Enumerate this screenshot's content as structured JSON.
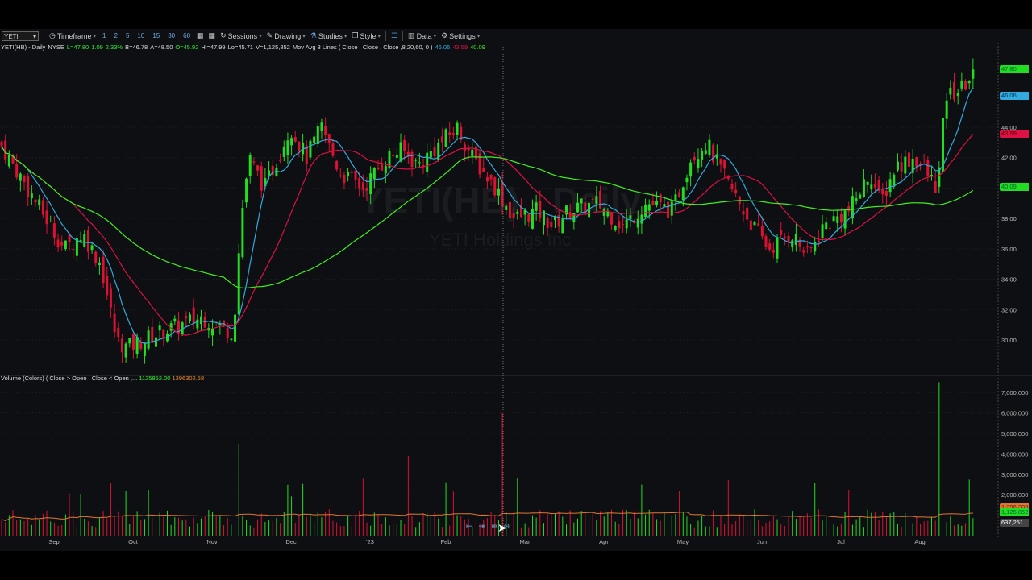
{
  "toolbar": {
    "symbol": "YETI",
    "timeframe": "Timeframe",
    "intervals": [
      "1",
      "2",
      "5",
      "10",
      "15",
      "30",
      "60"
    ],
    "sessions": "Sessions",
    "drawing": "Drawing",
    "studies": "Studies",
    "style": "Style",
    "data": "Data",
    "settings": "Settings"
  },
  "info": {
    "title": "YETI(HB) - Daily",
    "exchange": "NYSE",
    "last": "L=47.80",
    "change": "1.09",
    "pct": "2.33%",
    "bid": "B=46.78",
    "ask": "A=48.50",
    "open": "O=45.92",
    "high": "Hi=47.99",
    "low": "Lo=45.71",
    "volume": "V=1,125,852",
    "study": "Mov Avg 3 Lines ( Close , Close , Close ,8,20,60, 0 )",
    "ma1": "46.06",
    "ma2": "43.59",
    "ma3": "40.09"
  },
  "volume_info": {
    "label": "Volume (Colors) ( Close > Open , Close < Open ,...",
    "v1": "1125852.00",
    "v2": "1396302.58"
  },
  "watermark": {
    "title": "YETI(HB) - Daily",
    "company": "YETI Holdings Inc"
  },
  "colors": {
    "up": "#22dd22",
    "down": "#dd1133",
    "ma8": "#33aadd",
    "ma20": "#dd1144",
    "ma60": "#44ee22",
    "volavg": "#dd7733"
  },
  "price_axis": [
    "44.00",
    "42.00",
    "40.00",
    "38.00",
    "36.00",
    "34.00",
    "32.00",
    "30.00"
  ],
  "price_tags": {
    "last": "47.80",
    "ma8": "46.06",
    "ma20": "43.59",
    "ma60": "40.09"
  },
  "volume_axis": [
    "7,000,000",
    "6,000,000",
    "5,000,000",
    "4,000,000",
    "3,000,000",
    "2,000,000"
  ],
  "volume_tags": {
    "avg": "1,396,303",
    "last": "1,125,852",
    "cursor": "637,251"
  },
  "months": [
    "Sep",
    "Oct",
    "Nov",
    "Dec",
    "'23",
    "Feb",
    "Mar",
    "Apr",
    "May",
    "Jun",
    "Jul",
    "Aug"
  ],
  "chart_data": {
    "type": "candlestick",
    "moving_averages": [
      8,
      20,
      60
    ],
    "ylim": [
      29,
      48.5
    ],
    "volume_ylim": [
      0,
      7500000
    ],
    "close_path": [
      [
        "2022-08-11",
        43
      ],
      [
        "2022-09-05",
        36
      ],
      [
        "2022-09-12",
        37
      ],
      [
        "2022-09-19",
        35
      ],
      [
        "2022-09-25",
        30
      ],
      [
        "2022-09-29",
        29.5
      ],
      [
        "2022-10-12",
        30.5
      ],
      [
        "2022-10-28",
        31.5
      ],
      [
        "2022-11-09",
        30.5
      ],
      [
        "2022-11-12",
        38
      ],
      [
        "2022-11-15",
        42
      ],
      [
        "2022-11-21",
        40
      ],
      [
        "2022-12-01",
        44
      ],
      [
        "2022-12-07",
        42
      ],
      [
        "2022-12-13",
        44
      ],
      [
        "2022-12-20",
        41
      ],
      [
        "2022-12-29",
        40
      ],
      [
        "2023-01-07",
        42
      ],
      [
        "2023-01-13",
        42.5
      ],
      [
        "2023-01-19",
        41.5
      ],
      [
        "2023-02-03",
        44
      ],
      [
        "2023-02-09",
        42
      ],
      [
        "2023-02-18",
        40
      ],
      [
        "2023-02-25",
        38
      ],
      [
        "2023-03-06",
        38.5
      ],
      [
        "2023-03-12",
        37.5
      ],
      [
        "2023-03-18",
        38.5
      ],
      [
        "2023-03-29",
        39
      ],
      [
        "2023-04-08",
        37.5
      ],
      [
        "2023-04-17",
        39
      ],
      [
        "2023-04-27",
        38.5
      ],
      [
        "2023-05-04",
        42
      ],
      [
        "2023-05-10",
        43
      ],
      [
        "2023-05-16",
        41
      ],
      [
        "2023-05-26",
        38
      ],
      [
        "2023-06-03",
        36
      ],
      [
        "2023-06-12",
        37
      ],
      [
        "2023-06-18",
        35.5
      ],
      [
        "2023-06-24",
        37.5
      ],
      [
        "2023-07-04",
        38.5
      ],
      [
        "2023-07-12",
        41
      ],
      [
        "2023-07-16",
        39
      ],
      [
        "2023-07-22",
        41.5
      ],
      [
        "2023-07-29",
        42
      ],
      [
        "2023-08-07",
        40
      ],
      [
        "2023-08-10",
        46
      ],
      [
        "2023-08-16",
        46.5
      ],
      [
        "2023-08-22",
        47.8
      ]
    ]
  }
}
